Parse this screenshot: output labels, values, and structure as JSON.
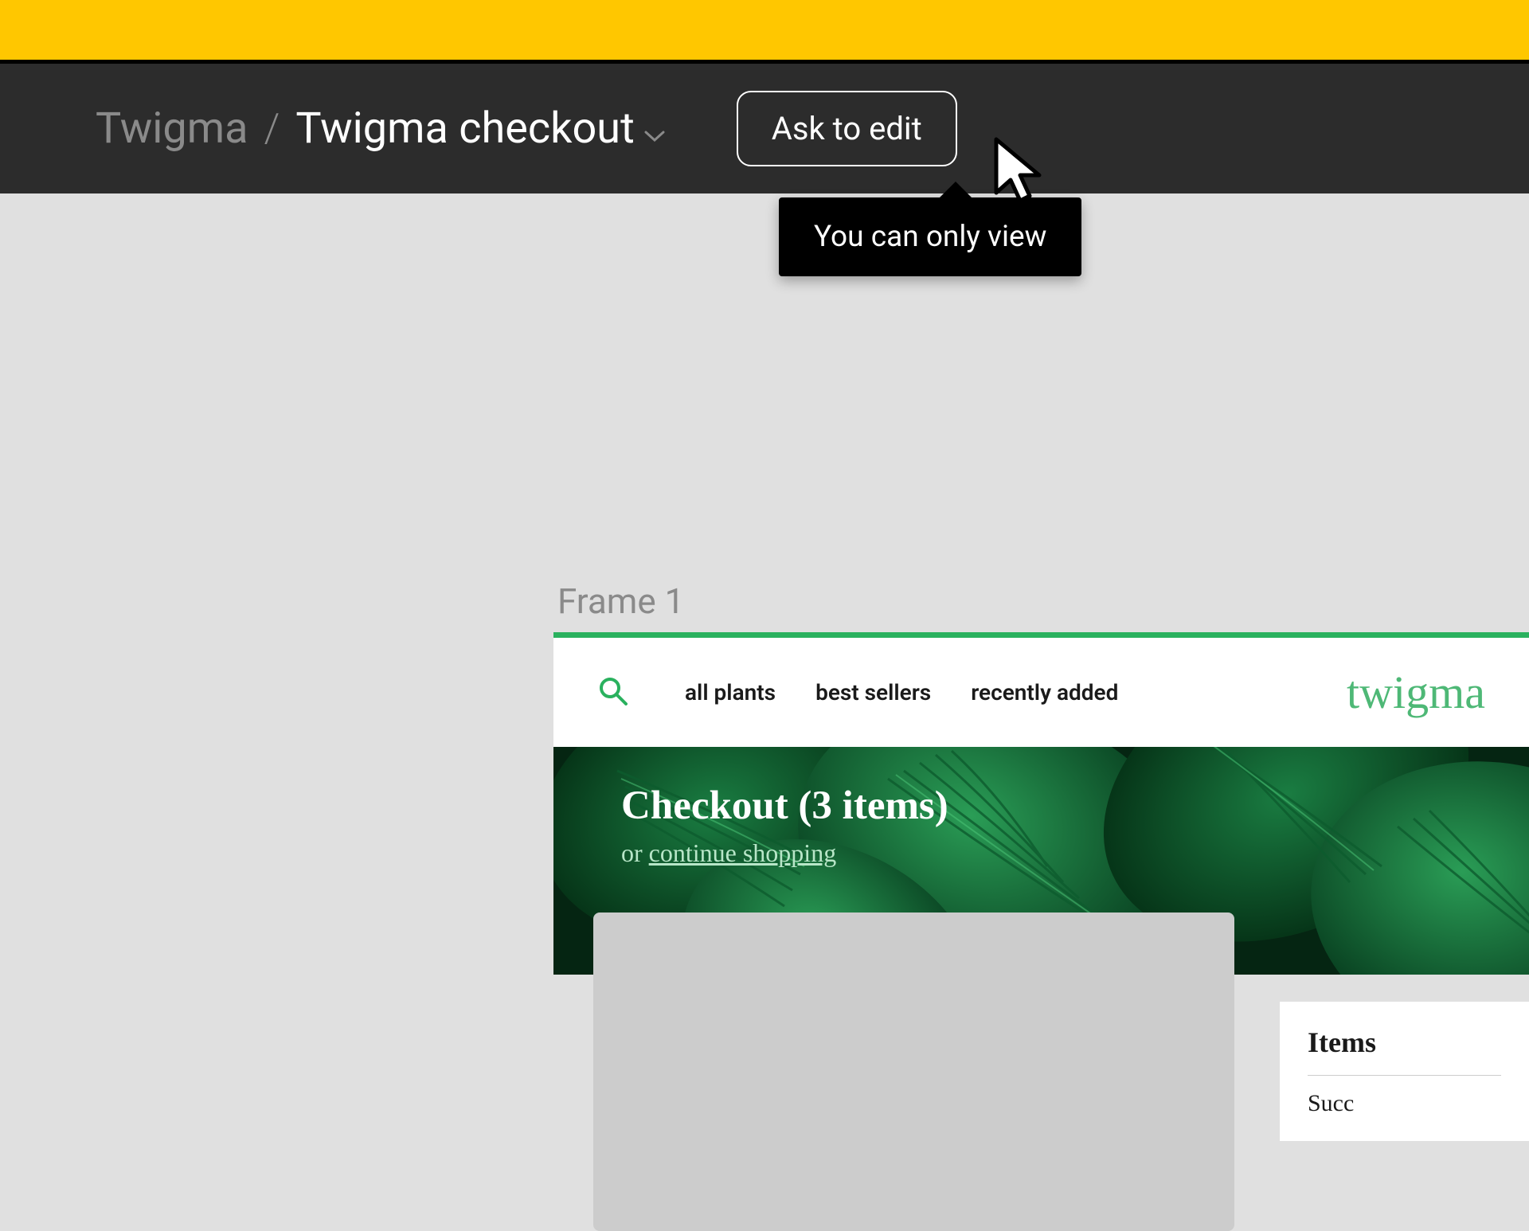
{
  "toolbar": {
    "breadcrumb_parent": "Twigma",
    "breadcrumb_current": "Twigma checkout",
    "ask_to_edit_label": "Ask to edit"
  },
  "tooltip": {
    "text": "You can only view"
  },
  "canvas": {
    "frame_label": "Frame 1"
  },
  "mockup": {
    "nav": {
      "items": [
        "all plants",
        "best sellers",
        "recently added"
      ]
    },
    "logo_text": "twigma",
    "hero": {
      "title": "Checkout (3 items)",
      "subtitle_prefix": "or ",
      "subtitle_link": "continue shopping"
    },
    "sidebar": {
      "title": "Items",
      "subrow": "Succ"
    }
  }
}
